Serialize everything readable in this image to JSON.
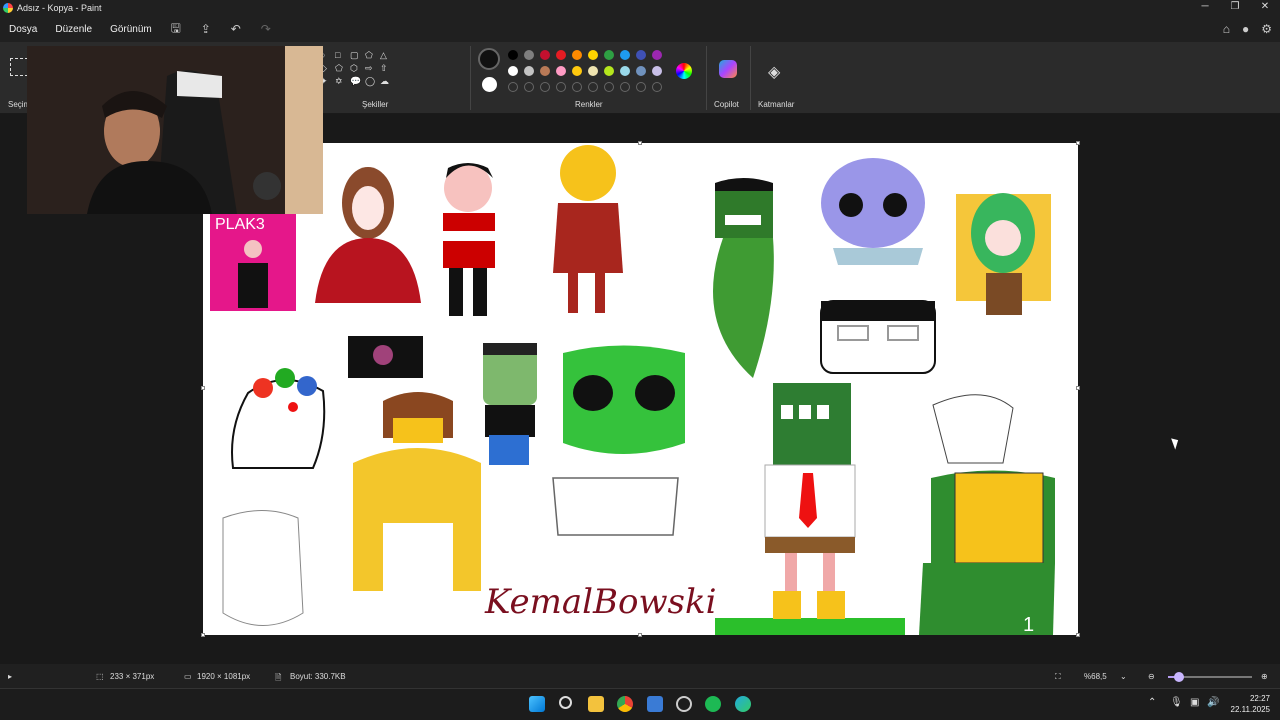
{
  "window": {
    "title": "Adsız - Kopya - Paint"
  },
  "menu": {
    "file": "Dosya",
    "edit": "Düzenle",
    "view": "Görünüm"
  },
  "ribbon": {
    "selection_label": "Seçim",
    "shapes_label": "Şekiller",
    "colors_label": "Renkler",
    "copilot_label": "Copilot",
    "layers_label": "Katmanlar",
    "palette": [
      "#000000",
      "#7f7f7f",
      "#c3102f",
      "#e51c23",
      "#ff8a00",
      "#ffd400",
      "#2ea043",
      "#1e9bf0",
      "#3f51b5",
      "#9c27b0",
      "#ffffff",
      "#c3c3c3",
      "#b97a57",
      "#ff9bc4",
      "#ffc90e",
      "#efe4b0",
      "#b5e61d",
      "#99d9ea",
      "#7092be",
      "#c8bfe7"
    ],
    "primary_color": "#111111",
    "secondary_color": "#ffffff"
  },
  "canvas": {
    "drawings": [
      "PLAK3",
      "KemalBowski",
      "1"
    ]
  },
  "status": {
    "selection_size": "233 × 371px",
    "canvas_size": "1920 × 1081px",
    "file_size": "Boyut: 330.7KB",
    "zoom": "%68,5",
    "zoom_level": 0.1
  },
  "taskbar": {
    "time": "22:27",
    "date": "22.11.2025"
  }
}
